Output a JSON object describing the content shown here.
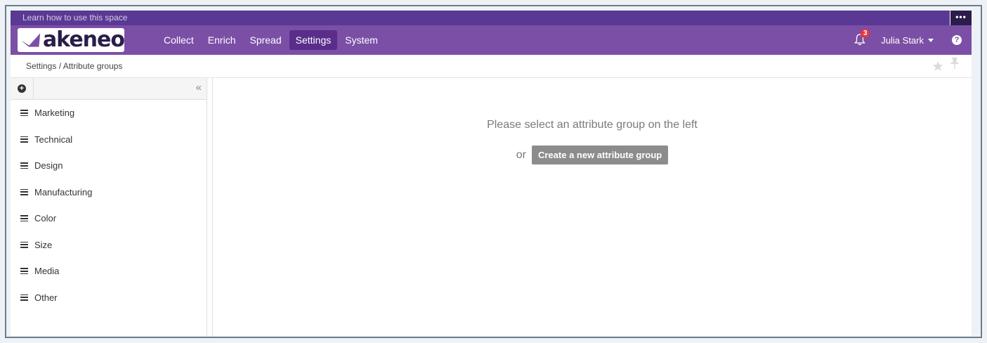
{
  "topbar": {
    "learn_text": "Learn how to use this space",
    "more_label": "•••"
  },
  "navbar": {
    "logo_text": "akeneo",
    "items": [
      {
        "label": "Collect",
        "active": false
      },
      {
        "label": "Enrich",
        "active": false
      },
      {
        "label": "Spread",
        "active": false
      },
      {
        "label": "Settings",
        "active": true
      },
      {
        "label": "System",
        "active": false
      }
    ],
    "notifications_count": "3",
    "user_name": "Julia Stark",
    "help_label": "?"
  },
  "breadcrumb": {
    "text": "Settings / Attribute groups"
  },
  "sidebar": {
    "add_label": "+",
    "collapse_label": "«",
    "groups": [
      {
        "label": "Marketing"
      },
      {
        "label": "Technical"
      },
      {
        "label": "Design"
      },
      {
        "label": "Manufacturing"
      },
      {
        "label": "Color"
      },
      {
        "label": "Size"
      },
      {
        "label": "Media"
      },
      {
        "label": "Other"
      }
    ]
  },
  "content": {
    "message": "Please select an attribute group on the left",
    "or_text": "or",
    "create_label": "Create a new attribute group"
  },
  "colors": {
    "topbar": "#5a3994",
    "navbar": "#7b4fa6",
    "active_nav": "#5a2d8a",
    "badge": "#e23540",
    "create_button": "#8c8c8c"
  },
  "icons": [
    "more-icon",
    "logo-icon",
    "bell-icon",
    "caret-down-icon",
    "help-icon",
    "star-icon",
    "pin-icon",
    "add-icon",
    "collapse-icon",
    "hamburger-icon"
  ]
}
